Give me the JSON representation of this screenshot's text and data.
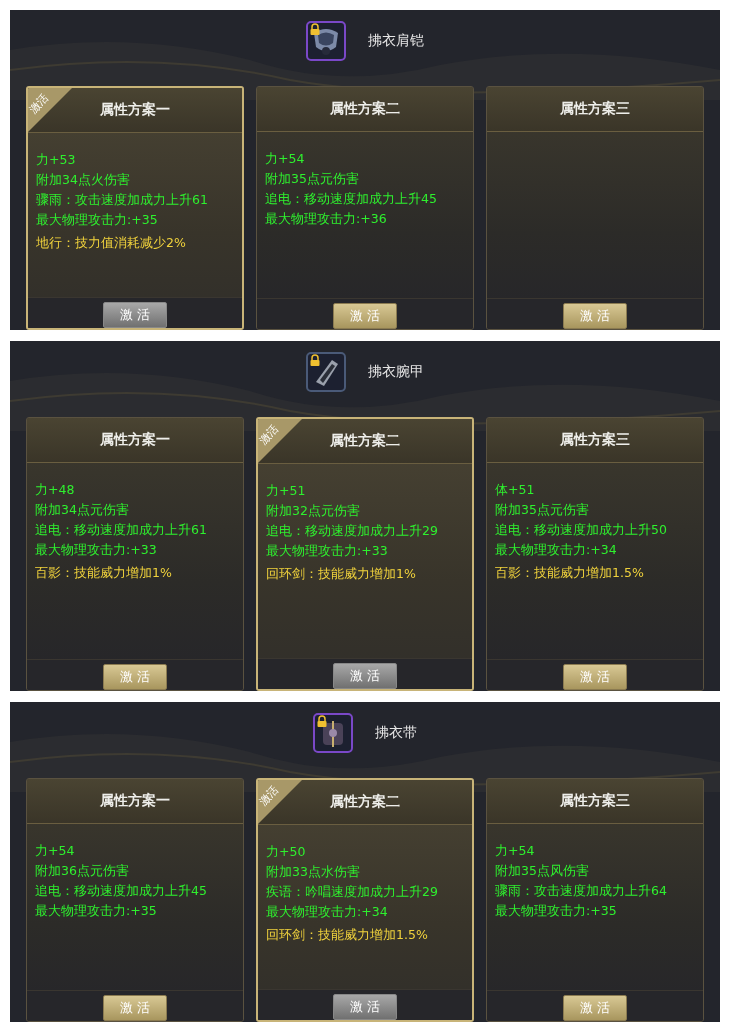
{
  "panels": [
    {
      "item_name": "拂衣肩铠",
      "active_badge": "激活",
      "cards": [
        {
          "title": "属性方案一",
          "selected": true,
          "button": "激 活",
          "lines": [
            {
              "text": "力+53",
              "kind": "bonus"
            },
            {
              "text": "附加34点火伤害",
              "kind": "bonus"
            },
            {
              "text": "骤雨：攻击速度加成力上升61",
              "kind": "bonus"
            },
            {
              "text": "最大物理攻击力:+35",
              "kind": "bonus"
            },
            {
              "text": "地行：技力值消耗减少2%",
              "kind": "special"
            }
          ]
        },
        {
          "title": "属性方案二",
          "selected": false,
          "button": "激 活",
          "lines": [
            {
              "text": "力+54",
              "kind": "bonus"
            },
            {
              "text": "附加35点元伤害",
              "kind": "bonus"
            },
            {
              "text": "追电：移动速度加成力上升45",
              "kind": "bonus"
            },
            {
              "text": "最大物理攻击力:+36",
              "kind": "bonus"
            }
          ]
        },
        {
          "title": "属性方案三",
          "selected": false,
          "button": "激 活"
        }
      ]
    },
    {
      "item_name": "拂衣腕甲",
      "active_badge": "激活",
      "cards": [
        {
          "title": "属性方案一",
          "selected": false,
          "button": "激 活",
          "lines": [
            {
              "text": "力+48",
              "kind": "bonus"
            },
            {
              "text": "附加34点元伤害",
              "kind": "bonus"
            },
            {
              "text": "追电：移动速度加成力上升61",
              "kind": "bonus"
            },
            {
              "text": "最大物理攻击力:+33",
              "kind": "bonus"
            },
            {
              "text": "百影：技能威力增加1%",
              "kind": "special"
            }
          ]
        },
        {
          "title": "属性方案二",
          "selected": true,
          "button": "激 活",
          "lines": [
            {
              "text": "力+51",
              "kind": "bonus"
            },
            {
              "text": "附加32点元伤害",
              "kind": "bonus"
            },
            {
              "text": "追电：移动速度加成力上升29",
              "kind": "bonus"
            },
            {
              "text": "最大物理攻击力:+33",
              "kind": "bonus"
            },
            {
              "text": "回环剑：技能威力增加1%",
              "kind": "special"
            }
          ]
        },
        {
          "title": "属性方案三",
          "selected": false,
          "button": "激 活",
          "lines": [
            {
              "text": "体+51",
              "kind": "bonus"
            },
            {
              "text": "附加35点元伤害",
              "kind": "bonus"
            },
            {
              "text": "追电：移动速度加成力上升50",
              "kind": "bonus"
            },
            {
              "text": "最大物理攻击力:+34",
              "kind": "bonus"
            },
            {
              "text": "百影：技能威力增加1.5%",
              "kind": "special"
            }
          ]
        }
      ]
    },
    {
      "item_name": "拂衣带",
      "active_badge": "激活",
      "cards": [
        {
          "title": "属性方案一",
          "selected": false,
          "button": "激 活",
          "lines": [
            {
              "text": "力+54",
              "kind": "bonus"
            },
            {
              "text": "附加36点元伤害",
              "kind": "bonus"
            },
            {
              "text": "追电：移动速度加成力上升45",
              "kind": "bonus"
            },
            {
              "text": "最大物理攻击力:+35",
              "kind": "bonus"
            }
          ]
        },
        {
          "title": "属性方案二",
          "selected": true,
          "button": "激 活",
          "lines": [
            {
              "text": "力+50",
              "kind": "bonus"
            },
            {
              "text": "附加33点水伤害",
              "kind": "bonus"
            },
            {
              "text": "疾语：吟唱速度加成力上升29",
              "kind": "bonus"
            },
            {
              "text": "最大物理攻击力:+34",
              "kind": "bonus"
            },
            {
              "text": "回环剑：技能威力增加1.5%",
              "kind": "special"
            }
          ]
        },
        {
          "title": "属性方案三",
          "selected": false,
          "button": "激 活",
          "lines": [
            {
              "text": "力+54",
              "kind": "bonus"
            },
            {
              "text": "附加35点风伤害",
              "kind": "bonus"
            },
            {
              "text": "骤雨：攻击速度加成力上升64",
              "kind": "bonus"
            },
            {
              "text": "最大物理攻击力:+35",
              "kind": "bonus"
            }
          ]
        }
      ]
    }
  ]
}
